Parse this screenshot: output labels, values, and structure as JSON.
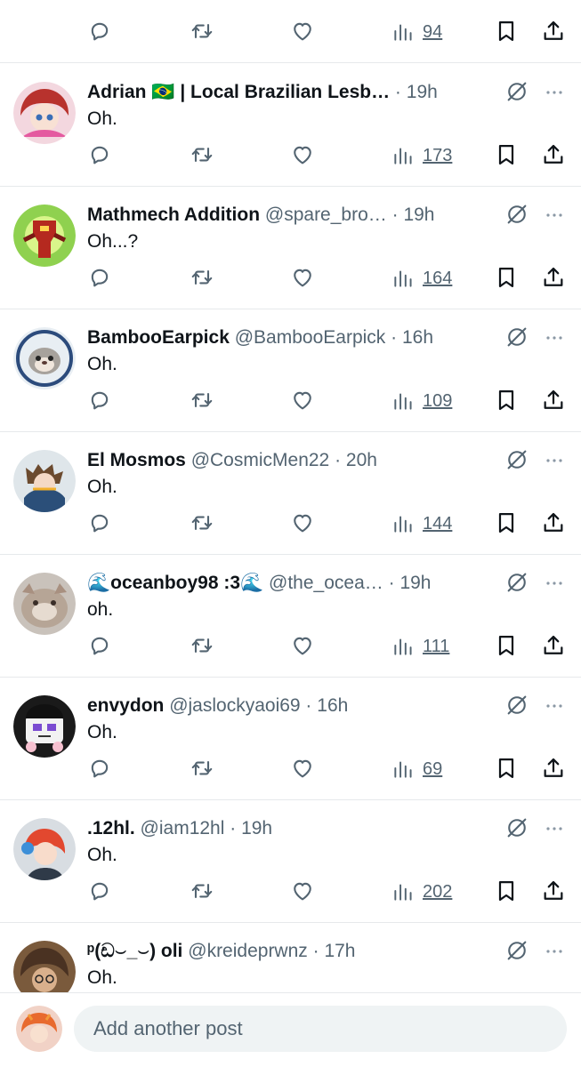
{
  "colors": {
    "text": "#0f1419",
    "secondary": "#536471",
    "divider": "#e6e9eb",
    "composer_bg": "#eff3f4"
  },
  "icons": {
    "reply": "reply-icon",
    "repost": "repost-icon",
    "like": "heart-icon",
    "views": "views-chart-icon",
    "bookmark": "bookmark-icon",
    "share": "share-icon",
    "mute": "mute-conversation-icon",
    "more": "more-options-icon"
  },
  "posts": [
    {
      "name": "",
      "handle": "",
      "time": "",
      "text": "",
      "views": "94"
    },
    {
      "name": "Adrian 🇧🇷 | Local Brazilian Lesb…",
      "handle": "",
      "time": "19h",
      "text": "Oh.",
      "views": "173"
    },
    {
      "name": "Mathmech Addition",
      "handle": "@spare_bro…",
      "time": "19h",
      "text": "Oh...?",
      "views": "164"
    },
    {
      "name": "BambooEarpick",
      "handle": "@BambooEarpick",
      "time": "16h",
      "text": "Oh.",
      "views": "109"
    },
    {
      "name": "El Mosmos",
      "handle": "@CosmicMen22",
      "time": "20h",
      "text": "Oh.",
      "views": "144"
    },
    {
      "name": "🌊oceanboy98 :3🌊",
      "handle": "@the_ocea…",
      "time": "19h",
      "text": "oh.",
      "views": "111"
    },
    {
      "name": "envydon",
      "handle": "@jaslockyaoi69",
      "time": "16h",
      "text": "Oh.",
      "views": "69"
    },
    {
      "name": ".12hl.",
      "handle": "@iam12hl",
      "time": "19h",
      "text": "Oh.",
      "views": "202"
    },
    {
      "name": "ᵖ(ඩ⌣_⌣) oli",
      "handle": "@kreideprwnz",
      "time": "17h",
      "text": "Oh.",
      "views": ""
    }
  ],
  "composer": {
    "placeholder": "Add another post"
  }
}
